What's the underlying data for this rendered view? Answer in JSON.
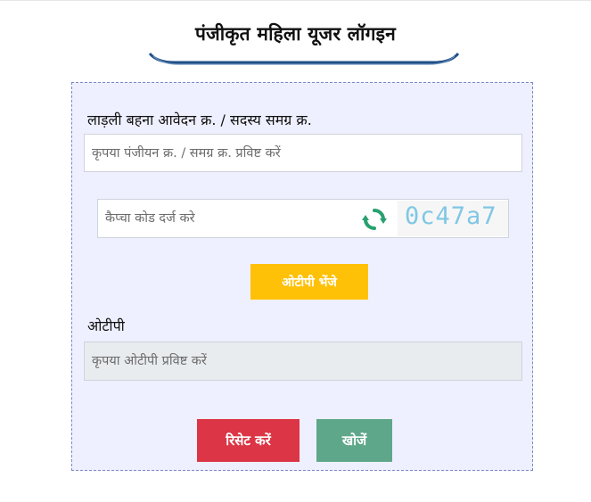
{
  "header": {
    "title": "पंजीकृत महिला यूजर लॉगइन"
  },
  "form": {
    "id_label": "लाड़ली बहना आवेदन क्र. / सदस्य समग्र क्र.",
    "id_placeholder": "कृपया पंजीयन क्र. / समग्र क्र. प्रविष्ट करें",
    "captcha_placeholder": "कैप्चा कोड दर्ज करे",
    "captcha_code": "0c47a7",
    "refresh_icon": "refresh-icon",
    "send_otp_label": "ओटीपी भेंजे",
    "otp_label": "ओटीपी",
    "otp_placeholder": "कृपया ओटीपी प्रविष्ट करें",
    "reset_label": "रिसेट करें",
    "search_label": "खोजें"
  },
  "colors": {
    "card_bg": "#eef0ff",
    "card_border": "#7c86c9",
    "underline": "#1f4f86",
    "otp_button": "#ffc107",
    "reset_button": "#dc3545",
    "search_button": "#5fa78a",
    "captcha_text": "#7fc7e4",
    "refresh_icon": "#28a06f"
  }
}
